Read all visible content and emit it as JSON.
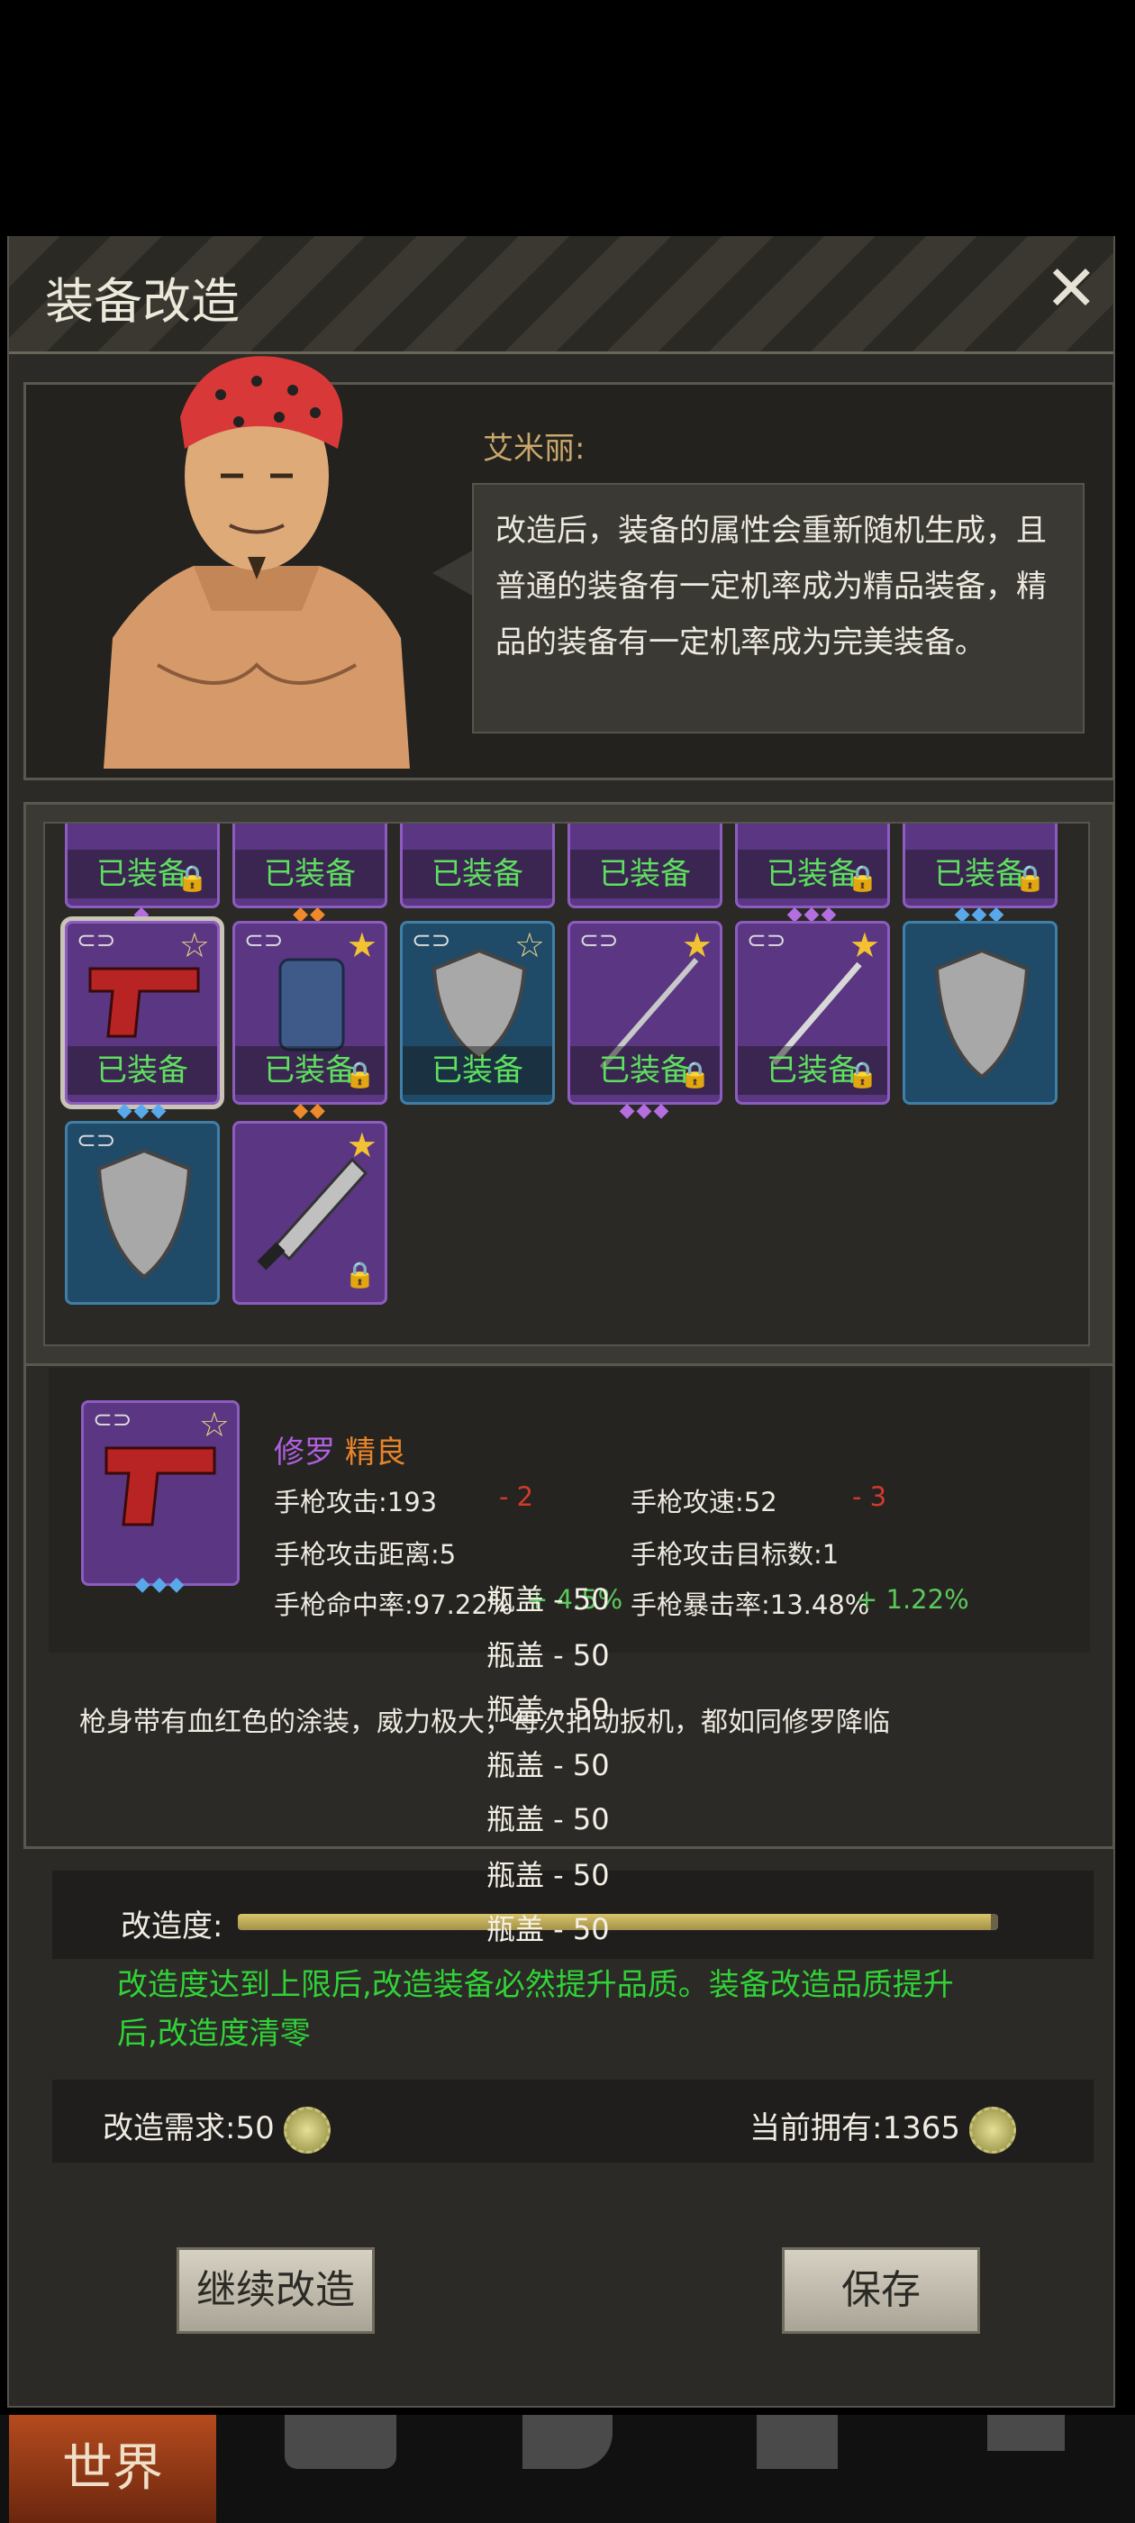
{
  "dialog": {
    "title": "装备改造",
    "close": "✕"
  },
  "npc": {
    "name": "艾米丽:",
    "speech": "改造后，装备的属性会重新随机生成，且普通的装备有一定机率成为精品装备，精品的装备有一定机率成为完美装备。"
  },
  "grid": {
    "equipped_label": "已装备",
    "row0": [
      {
        "color": "purple",
        "equipped": true,
        "locked": true
      },
      {
        "color": "purple",
        "equipped": true,
        "locked": false
      },
      {
        "color": "purple",
        "equipped": true,
        "locked": false
      },
      {
        "color": "purple",
        "equipped": true,
        "locked": false
      },
      {
        "color": "purple",
        "equipped": true,
        "locked": true
      },
      {
        "color": "purple",
        "equipped": true,
        "locked": true
      }
    ]
  },
  "item": {
    "name_prefix": "修罗",
    "name_quality": "精良",
    "stats": {
      "atk_label": "手枪攻击:",
      "atk_value": "193",
      "atk_delta": "- 2",
      "spd_label": "手枪攻速:",
      "spd_value": "52",
      "spd_delta": "- 3",
      "range_label": "手枪攻击距离:",
      "range_value": "5",
      "targets_label": "手枪攻击目标数:",
      "targets_value": "1",
      "hit_label": "手枪命中率:",
      "hit_value": "97.22%",
      "hit_delta": "+ 4.5%",
      "crit_label": "手枪暴击率:",
      "crit_value": "13.48%",
      "crit_delta": "+ 1.22%"
    },
    "description": "枪身带有血红色的涂装，威力极大，每次扣动扳机，都如同修罗降临"
  },
  "floating_costs": [
    "瓶盖 - 50",
    "瓶盖 - 50",
    "瓶盖 - 50",
    "瓶盖 - 50",
    "瓶盖 - 50",
    "瓶盖 - 50",
    "瓶盖 - 50"
  ],
  "progress": {
    "label": "改造度:",
    "fraction": 0.99
  },
  "note": "改造度达到上限后,改造装备必然提升品质。装备改造品质提升后,改造度清零",
  "cost": {
    "required_label": "改造需求:",
    "required_value": "50",
    "owned_label": "当前拥有:",
    "owned_value": "1365"
  },
  "buttons": {
    "continue": "继续改造",
    "save": "保存"
  },
  "nav": {
    "world": "世界"
  },
  "colors": {
    "equipped_green": "#5ee05e",
    "quality_orange": "#e8842a",
    "name_purple": "#b060e0",
    "note_green": "#31d238"
  }
}
